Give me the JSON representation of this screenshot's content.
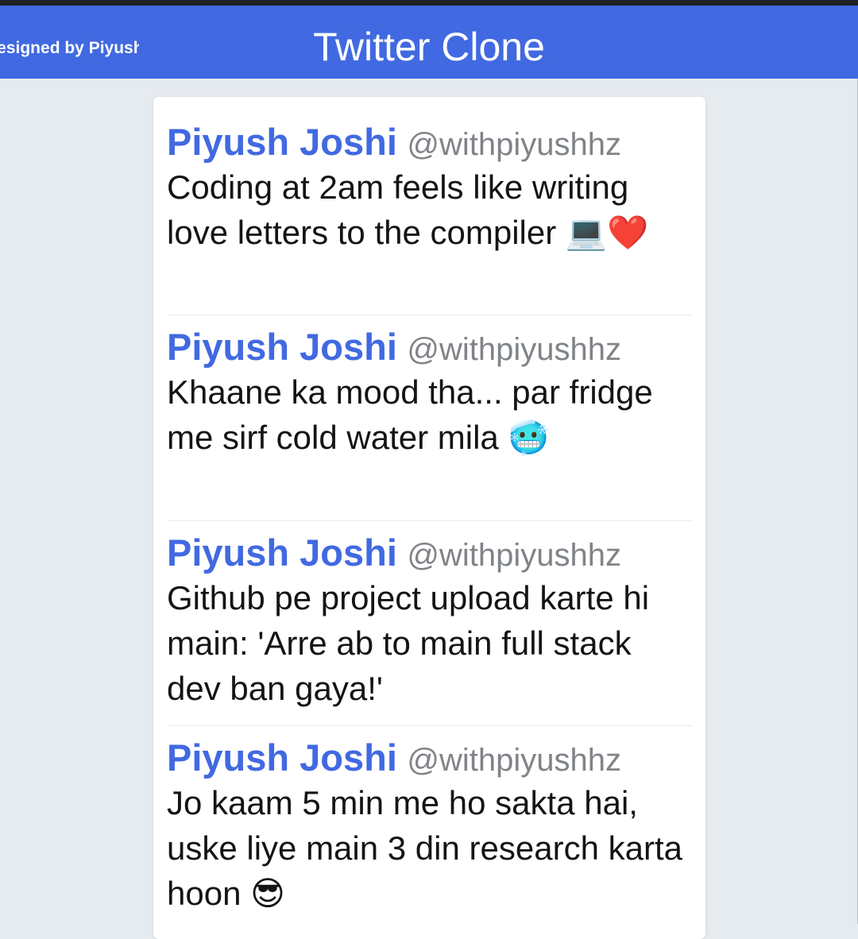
{
  "header": {
    "designer_text": "Designed by Piyush",
    "sparkle": "✨",
    "title": "Twitter Clone"
  },
  "tweets": [
    {
      "author": "Piyush Joshi",
      "handle": "@withpiyushhz",
      "text": "Coding at 2am feels like writing love letters to the compiler 💻❤️"
    },
    {
      "author": "Piyush Joshi",
      "handle": "@withpiyushhz",
      "text": "Khaane ka mood tha... par fridge me sirf cold water mila 🥶"
    },
    {
      "author": "Piyush Joshi",
      "handle": "@withpiyushhz",
      "text": "Github pe project upload karte hi main: 'Arre ab to main full stack dev ban gaya!'"
    },
    {
      "author": "Piyush Joshi",
      "handle": "@withpiyushhz",
      "text": "Jo kaam 5 min me ho sakta hai, uske liye main 3 din research karta hoon 😎"
    }
  ],
  "colors": {
    "header_bg": "#4169e1",
    "author": "#4169e1",
    "handle": "#808488",
    "page_bg": "#e6ebf0"
  }
}
